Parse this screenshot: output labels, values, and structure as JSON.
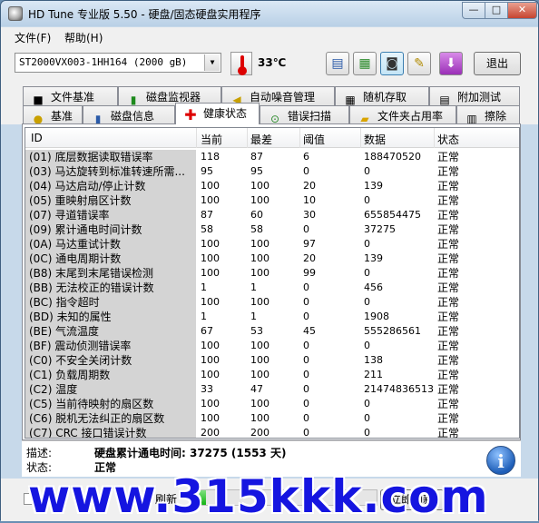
{
  "window": {
    "title": "HD Tune 专业版 5.50 - 硬盘/固态硬盘实用程序",
    "min_label": "—",
    "max_label": "□",
    "close_label": "✕"
  },
  "menu": [
    "文件(F)",
    "帮助(H)"
  ],
  "toolbar": {
    "drive": "ST2000VX003-1HH164 (2000 gB)",
    "temperature": "33℃",
    "exit_label": "退出",
    "buttons": [
      {
        "icon": "copy-icon",
        "glyph": "▤"
      },
      {
        "icon": "save-icon",
        "glyph": "▦"
      },
      {
        "icon": "camera-icon",
        "glyph": "◙"
      },
      {
        "icon": "wrench-icon",
        "glyph": "✎"
      },
      {
        "icon": "download-arrow-icon",
        "glyph": "⬇"
      }
    ]
  },
  "tabs_row1": [
    "文件基准",
    "磁盘监视器",
    "自动噪音管理",
    "随机存取",
    "附加测试"
  ],
  "tabs_row2": [
    "基准",
    "磁盘信息",
    "健康状态",
    "错误扫描",
    "文件夹占用率",
    "擦除"
  ],
  "active_tab": "健康状态",
  "table": {
    "headers": [
      "ID",
      "当前",
      "最差",
      "阈值",
      "数据",
      "状态"
    ],
    "rows": [
      [
        "(01) 底层数据读取错误率",
        "118",
        "87",
        "6",
        "188470520",
        "正常"
      ],
      [
        "(03) 马达旋转到标准转速所需...",
        "95",
        "95",
        "0",
        "0",
        "正常"
      ],
      [
        "(04) 马达启动/停止计数",
        "100",
        "100",
        "20",
        "139",
        "正常"
      ],
      [
        "(05) 重映射扇区计数",
        "100",
        "100",
        "10",
        "0",
        "正常"
      ],
      [
        "(07) 寻道错误率",
        "87",
        "60",
        "30",
        "655854475",
        "正常"
      ],
      [
        "(09) 累计通电时间计数",
        "58",
        "58",
        "0",
        "37275",
        "正常"
      ],
      [
        "(0A) 马达重试计数",
        "100",
        "100",
        "97",
        "0",
        "正常"
      ],
      [
        "(0C) 通电周期计数",
        "100",
        "100",
        "20",
        "139",
        "正常"
      ],
      [
        "(B8) 末尾到末尾错误检测",
        "100",
        "100",
        "99",
        "0",
        "正常"
      ],
      [
        "(BB) 无法校正的错误计数",
        "1",
        "1",
        "0",
        "456",
        "正常"
      ],
      [
        "(BC) 指令超时",
        "100",
        "100",
        "0",
        "0",
        "正常"
      ],
      [
        "(BD) 未知的属性",
        "1",
        "1",
        "0",
        "1908",
        "正常"
      ],
      [
        "(BE) 气流温度",
        "67",
        "53",
        "45",
        "555286561",
        "正常"
      ],
      [
        "(BF) 震动侦测错误率",
        "100",
        "100",
        "0",
        "0",
        "正常"
      ],
      [
        "(C0) 不安全关闭计数",
        "100",
        "100",
        "0",
        "138",
        "正常"
      ],
      [
        "(C1) 负载周期数",
        "100",
        "100",
        "0",
        "211",
        "正常"
      ],
      [
        "(C2) 温度",
        "33",
        "47",
        "0",
        "21474836513",
        "正常"
      ],
      [
        "(C5) 当前待映射的扇区数",
        "100",
        "100",
        "0",
        "0",
        "正常"
      ],
      [
        "(C6) 脱机无法纠正的扇区数",
        "100",
        "100",
        "0",
        "0",
        "正常"
      ],
      [
        "(C7) CRC 接口错误计数",
        "200",
        "200",
        "0",
        "0",
        "正常"
      ]
    ]
  },
  "description": {
    "desc_label": "描述:",
    "desc_value": "硬盘累计通电时间: 37275 (1553 天)",
    "status_label": "状态:",
    "status_value": "正常"
  },
  "bottom": {
    "refresh_label": "刷新",
    "refresh_now_label": "立即刷新",
    "progress_fraction": 0.05
  },
  "watermark": "www.315kkk.com"
}
